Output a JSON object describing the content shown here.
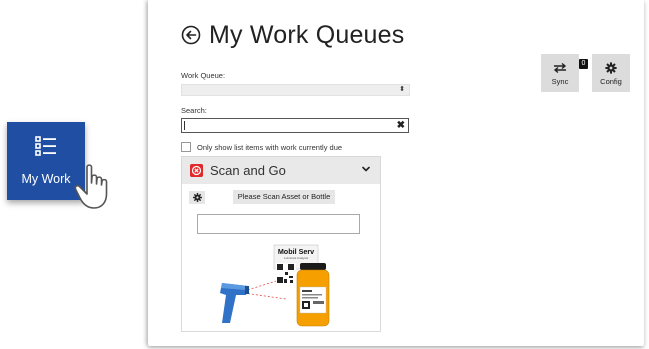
{
  "tile": {
    "label": "My Work",
    "icon": "list-icon",
    "color": "#1f4ea3"
  },
  "header": {
    "title": "My Work Queues",
    "back_icon": "back-arrow-icon"
  },
  "work_queue": {
    "label": "Work Queue:",
    "value": ""
  },
  "search": {
    "label": "Search:",
    "value": "",
    "clear_icon": "close-icon"
  },
  "filter": {
    "label": "Only show list items with work currently due",
    "checked": false
  },
  "scan_and_go": {
    "title": "Scan and Go",
    "button_label": "Please Scan Asset or Bottle",
    "input_value": "",
    "illustration_brand": "Mobil Serv",
    "illustration_sub": "Lubricant Analysis"
  },
  "toolbar": {
    "sync": {
      "label": "Sync",
      "badge": "0",
      "icon": "sync-icon"
    },
    "config": {
      "label": "Config",
      "icon": "gear-icon"
    }
  },
  "colors": {
    "accent": "#1f4ea3",
    "danger": "#e0292a",
    "bottle": "#f5a000",
    "scanner": "#2f72c7"
  }
}
